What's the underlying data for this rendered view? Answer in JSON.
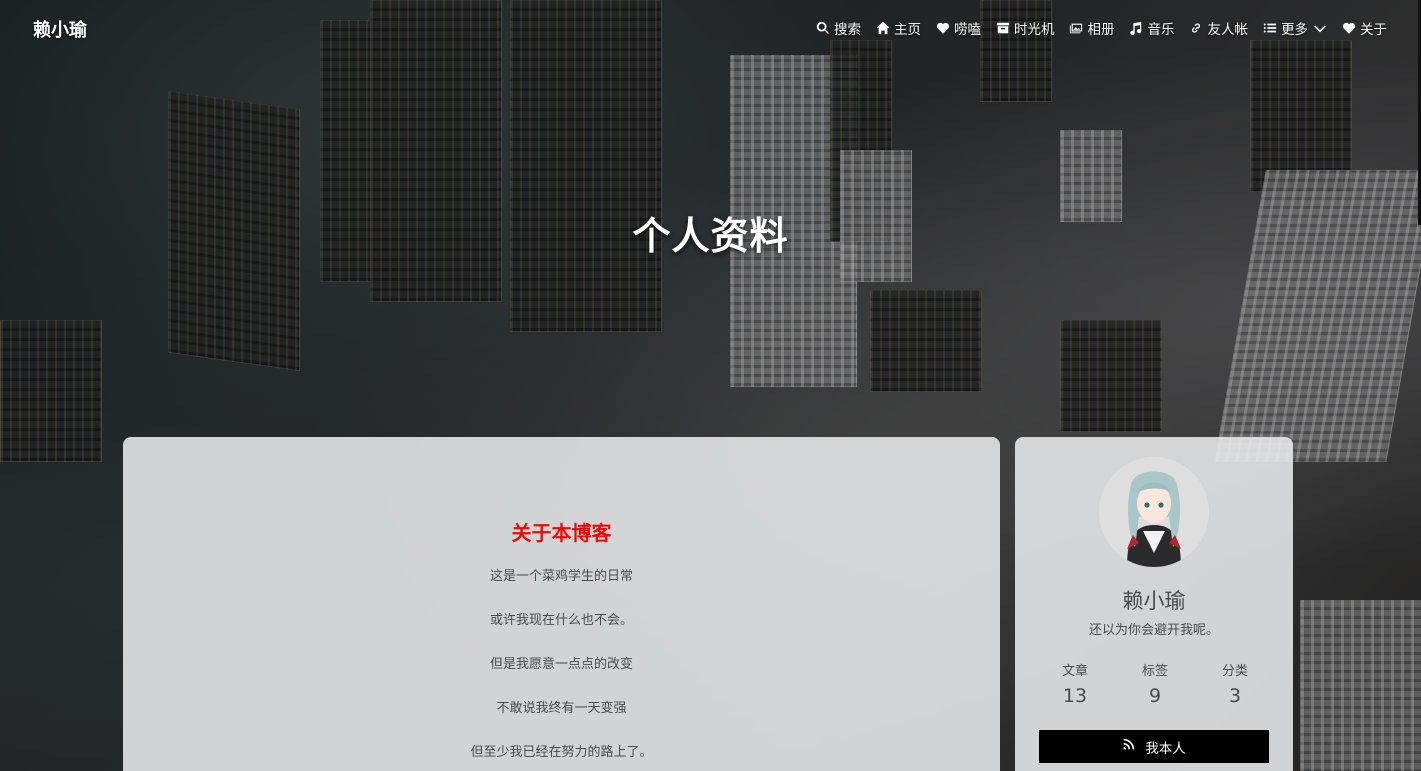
{
  "brand": "赖小瑜",
  "nav": [
    {
      "label": "搜索",
      "icon": "search-icon"
    },
    {
      "label": "主页",
      "icon": "home-icon"
    },
    {
      "label": "唠嗑",
      "icon": "heartbeat-icon"
    },
    {
      "label": "时光机",
      "icon": "archive-icon"
    },
    {
      "label": "相册",
      "icon": "images-icon"
    },
    {
      "label": "音乐",
      "icon": "music-icon"
    },
    {
      "label": "友人帐",
      "icon": "link-icon"
    },
    {
      "label": "更多",
      "icon": "list-icon"
    },
    {
      "label": "关于",
      "icon": "heart-icon"
    }
  ],
  "hero": {
    "title": "个人资料"
  },
  "about": {
    "title": "关于本博客",
    "lines": [
      "这是一个菜鸡学生的日常",
      "或许我现在什么也不会。",
      "但是我愿意一点点的改变",
      "不敢说我终有一天变强",
      "但至少我已经在努力的路上了。"
    ]
  },
  "profile": {
    "name": "赖小瑜",
    "motto": "还以为你会避开我呢。",
    "stats": [
      {
        "label": "文章",
        "value": "13"
      },
      {
        "label": "标签",
        "value": "9"
      },
      {
        "label": "分类",
        "value": "3"
      }
    ],
    "button_label": "我本人"
  },
  "colors": {
    "about_title": "#ee0a0a",
    "card_bg": "#e8eaec",
    "button_bg": "#000000"
  }
}
